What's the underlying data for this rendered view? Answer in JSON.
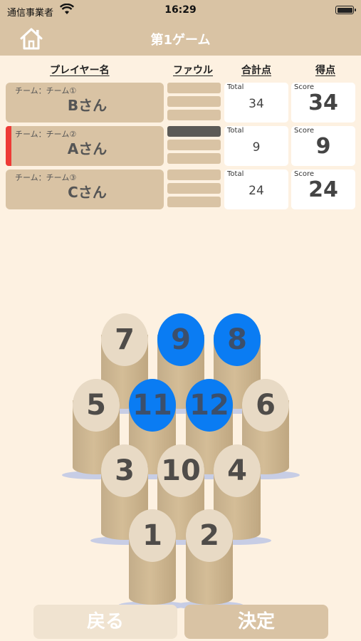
{
  "status_bar": {
    "carrier": "通信事業者",
    "time": "16:29"
  },
  "nav": {
    "title": "第1ゲーム",
    "home_icon": "home-icon"
  },
  "columns": {
    "player": "プレイヤー名",
    "foul": "ファウル",
    "total": "合計点",
    "score": "得点"
  },
  "players": [
    {
      "team": "チーム：チーム①",
      "name": "Bさん",
      "active": false,
      "fouls": 0,
      "total_label": "Total",
      "total": "34",
      "score_label": "Score",
      "score": "34"
    },
    {
      "team": "チーム：チーム②",
      "name": "Aさん",
      "active": true,
      "fouls": 1,
      "total_label": "Total",
      "total": "9",
      "score_label": "Score",
      "score": "9"
    },
    {
      "team": "チーム：チーム③",
      "name": "Cさん",
      "active": false,
      "fouls": 0,
      "total_label": "Total",
      "total": "24",
      "score_label": "Score",
      "score": "24"
    }
  ],
  "pins": [
    {
      "number": "7",
      "selected": false
    },
    {
      "number": "9",
      "selected": true
    },
    {
      "number": "8",
      "selected": true
    },
    {
      "number": "5",
      "selected": false
    },
    {
      "number": "11",
      "selected": true
    },
    {
      "number": "12",
      "selected": true
    },
    {
      "number": "6",
      "selected": false
    },
    {
      "number": "3",
      "selected": false
    },
    {
      "number": "10",
      "selected": false
    },
    {
      "number": "4",
      "selected": false
    },
    {
      "number": "1",
      "selected": false
    },
    {
      "number": "2",
      "selected": false
    }
  ],
  "buttons": {
    "back": "戻る",
    "confirm": "決定"
  },
  "colors": {
    "accent": "#d9c3a4",
    "background": "#fdf1e1",
    "selected_pin": "#0a7cf3",
    "active_marker": "#ee3b36",
    "foul_filled": "#5c5a57"
  }
}
